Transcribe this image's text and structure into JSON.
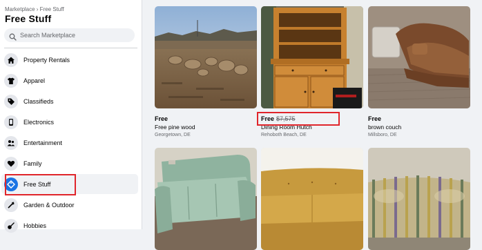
{
  "sidebar": {
    "breadcrumb": "Marketplace › Free Stuff",
    "title": "Free Stuff",
    "search_placeholder": "Search Marketplace",
    "categories": [
      {
        "label": "Property Rentals",
        "icon": "house-icon"
      },
      {
        "label": "Apparel",
        "icon": "shirt-icon"
      },
      {
        "label": "Classifieds",
        "icon": "tag-icon"
      },
      {
        "label": "Electronics",
        "icon": "phone-icon"
      },
      {
        "label": "Entertainment",
        "icon": "people-icon"
      },
      {
        "label": "Family",
        "icon": "heart-icon"
      },
      {
        "label": "Free Stuff",
        "icon": "free-tag-icon",
        "active": true
      },
      {
        "label": "Garden & Outdoor",
        "icon": "garden-tools-icon"
      },
      {
        "label": "Hobbies",
        "icon": "guitar-icon"
      }
    ]
  },
  "listings": [
    {
      "price": "Free",
      "title": "Free pine wood",
      "location": "Georgetown, DE"
    },
    {
      "price": "Free",
      "original_price": "$7,575",
      "title": "Dining Room Hutch",
      "location": "Rehoboth Beach, DE"
    },
    {
      "price": "Free",
      "title": "brown couch",
      "location": "Millsboro, DE"
    },
    {
      "price": "",
      "title": "",
      "location": ""
    },
    {
      "price": "",
      "title": "",
      "location": ""
    },
    {
      "price": "",
      "title": "",
      "location": ""
    }
  ],
  "colors": {
    "accent": "#1b74e4",
    "highlight": "#e0242a",
    "background": "#f0f2f5"
  }
}
